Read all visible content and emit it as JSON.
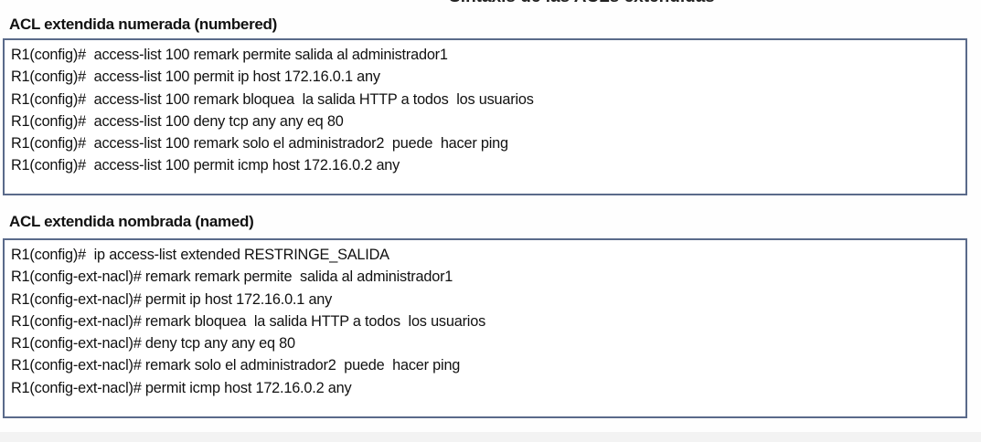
{
  "page_title": "Sintaxis de las ACLs extendidas",
  "numbered": {
    "heading": "ACL extendida numerada (numbered)",
    "lines": [
      "R1(config)#  access-list 100 remark permite salida al administrador1",
      "R1(config)#  access-list 100 permit ip host 172.16.0.1 any",
      "R1(config)#  access-list 100 remark bloquea  la salida HTTP a todos  los usuarios",
      "R1(config)#  access-list 100 deny tcp any any eq 80",
      "R1(config)#  access-list 100 remark solo el administrador2  puede  hacer ping",
      "R1(config)#  access-list 100 permit icmp host 172.16.0.2 any"
    ]
  },
  "named": {
    "heading": "ACL extendida nombrada (named)",
    "lines": [
      "R1(config)#  ip access-list extended RESTRINGE_SALIDA",
      "R1(config-ext-nacl)# remark remark permite  salida al administrador1",
      "R1(config-ext-nacl)# permit ip host 172.16.0.1 any",
      "R1(config-ext-nacl)# remark bloquea  la salida HTTP a todos  los usuarios",
      "R1(config-ext-nacl)# deny tcp any any eq 80",
      "R1(config-ext-nacl)# remark solo el administrador2  puede  hacer ping",
      "R1(config-ext-nacl)# permit icmp host 172.16.0.2 any"
    ]
  }
}
